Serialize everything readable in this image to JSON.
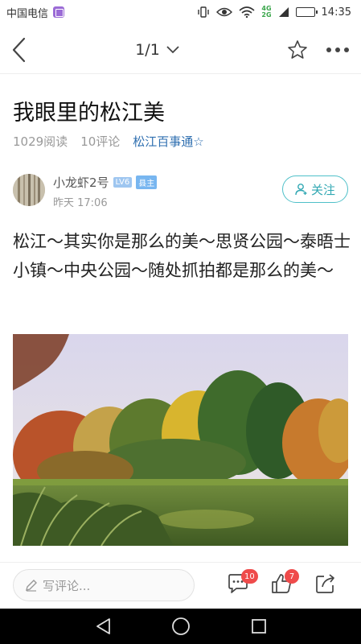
{
  "status_bar": {
    "carrier": "中国电信",
    "network_top": "4G",
    "network_bottom": "2G",
    "time": "14:35"
  },
  "nav": {
    "page_indicator": "1/1",
    "icons": [
      "back-arrow-icon",
      "chevron-down-icon",
      "star-icon",
      "more-icon"
    ]
  },
  "article": {
    "title": "我眼里的松江美",
    "reads": "1029阅读",
    "comments": "10评论",
    "source": "松江百事通☆",
    "body": "松江～其实你是那么的美～思贤公园～泰晤士小镇～中央公园～随处抓拍都是那么的美～"
  },
  "author": {
    "name": "小龙虾2号",
    "level": "LV6",
    "role": "县主",
    "time": "昨天 17:06",
    "follow_label": "关注"
  },
  "comment_bar": {
    "placeholder": "写评论...",
    "comment_count": "10",
    "like_count": "7"
  },
  "colors": {
    "accent": "#31a8b3",
    "link": "#2f6fb0",
    "badge_red": "#ef4b4b"
  }
}
